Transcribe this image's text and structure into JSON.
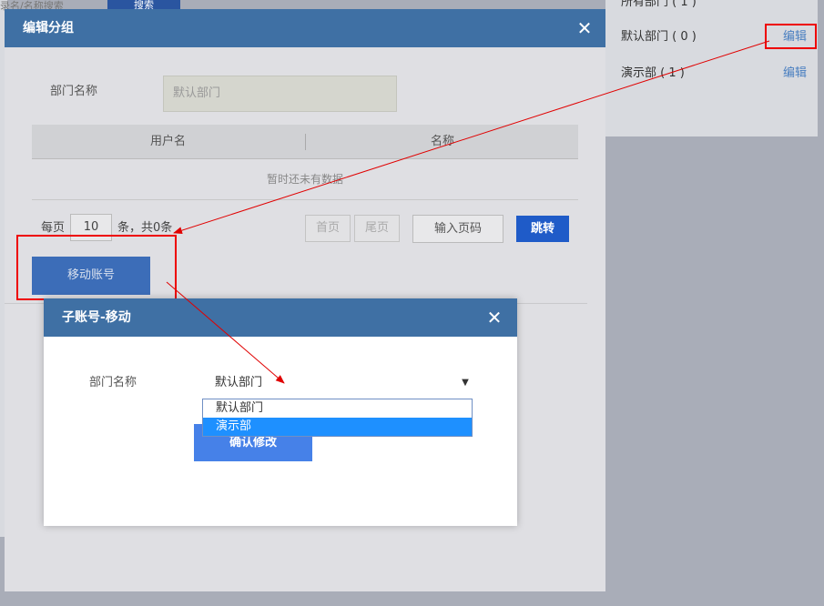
{
  "background": {
    "search_placeholder": "录名/名称搜索",
    "search_button": "搜索",
    "departments": [
      {
        "label": "所有部门 ( 1 )",
        "edit": ""
      },
      {
        "label": "默认部门 ( 0 )",
        "edit": "编辑"
      },
      {
        "label": "演示部 ( 1 )",
        "edit": "编辑"
      }
    ]
  },
  "edit_modal": {
    "title": "编辑分组",
    "dept_label": "部门名称",
    "dept_placeholder": "默认部门",
    "columns": [
      "用户名",
      "名称"
    ],
    "empty_text": "暂时还未有数据",
    "per_page_label": "每页",
    "per_page_value": "10",
    "total_label": "条，共0条",
    "first_page": "首页",
    "last_page": "尾页",
    "page_input_placeholder": "输入页码",
    "jump_button": "跳转",
    "move_button": "移动账号"
  },
  "move_modal": {
    "title": "子账号-移动",
    "dept_label": "部门名称",
    "selected": "默认部门",
    "options": [
      "默认部门",
      "演示部"
    ],
    "highlighted_option": "演示部",
    "confirm_button": "确认修改"
  },
  "colors": {
    "header": "#3f70a4",
    "primary_button": "#1f5bc8",
    "annotation": "#e00000",
    "dropdown_highlight": "#1e90ff"
  }
}
